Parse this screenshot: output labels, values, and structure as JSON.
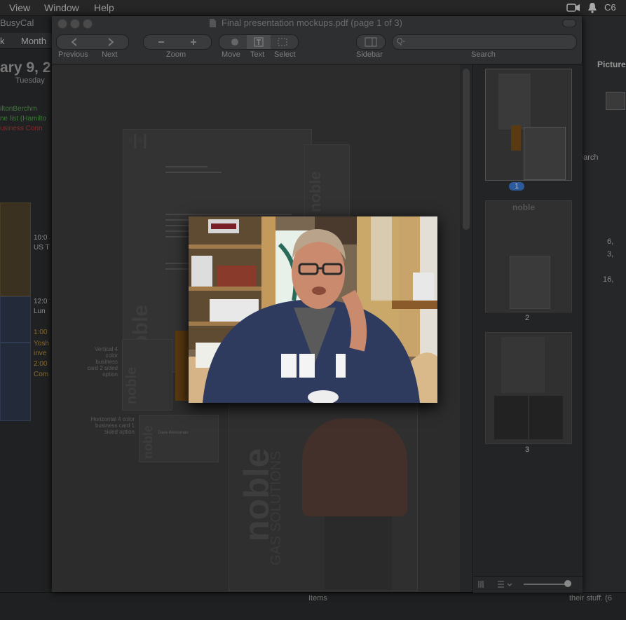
{
  "menubar": {
    "items": [
      "View",
      "Window",
      "Help"
    ],
    "right_text": "C6"
  },
  "calendar": {
    "app_title": "BusyCal",
    "segments": [
      "k",
      "Month"
    ],
    "date_heading": "ary 9, 2",
    "weekday": "Tuesday",
    "all_day_events": [
      {
        "text": "iltonBerchm",
        "color": "#3b7a36"
      },
      {
        "text": "ne list (Hamilto",
        "color": "#3b7a36"
      },
      {
        "text": "usiness Conn",
        "color": "#8a2b2b"
      }
    ],
    "events": [
      {
        "text": "10:0",
        "color": "#8d8d8d"
      },
      {
        "text": "US T",
        "color": "#8d8d8d"
      },
      {
        "text": "12:0",
        "color": "#8d8d8d"
      },
      {
        "text": "Lun",
        "color": "#8d8d8d"
      },
      {
        "text": "1:00",
        "color": "#8a6a2a"
      },
      {
        "text": "Yosh",
        "color": "#8a6a2a"
      },
      {
        "text": "inve",
        "color": "#8a6a2a"
      },
      {
        "text": "2:00",
        "color": "#8a6a2a"
      },
      {
        "text": "Com",
        "color": "#8a6a2a"
      }
    ]
  },
  "preview": {
    "title": "Final presentation mockups.pdf (page 1 of 3)",
    "toolbar": {
      "previous": "Previous",
      "next": "Next",
      "zoom": "Zoom",
      "move": "Move",
      "text": "Text",
      "select": "Select",
      "sidebar": "Sidebar",
      "search": "Search",
      "search_placeholder": "Q-"
    },
    "thumbnails": [
      {
        "label": "1",
        "selected": true
      },
      {
        "label": "2",
        "selected": false
      },
      {
        "label": "3",
        "selected": false
      }
    ],
    "document": {
      "logo_word": "noble",
      "logo_sub": "GAS SOLUTIONS",
      "vertical_note": "Vertical 4 color business card 2 sided option",
      "horizontal_note": "Horizontal 4 color business card 1 sided option",
      "card_name": "Dave Weissman"
    }
  },
  "right_app": {
    "label_top": "Picture",
    "label_search": "earch",
    "numbers": [
      "6,",
      "3,",
      "16,"
    ]
  },
  "bottom_strip": {
    "left_text": "Items",
    "right_text": "their stuff. (6"
  },
  "colors": {
    "background": "#1a1b1c",
    "selected_badge": "#2c5a9a",
    "orange_accent": "#5a3a10"
  }
}
